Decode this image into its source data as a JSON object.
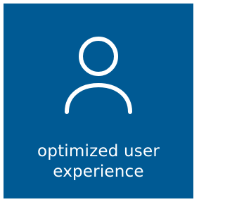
{
  "tile": {
    "background_color": "#005a94",
    "text_color": "#ffffff",
    "icon": "user-profile-icon",
    "caption_line1": "optimized user",
    "caption_line2": "experience"
  }
}
